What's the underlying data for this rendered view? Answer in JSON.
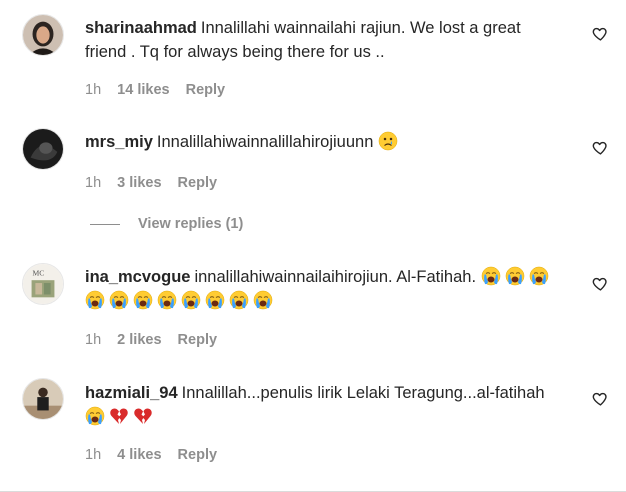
{
  "comments": [
    {
      "username": "sharinaahmad",
      "text": "Innalillahi wainnailahi rajiun. We lost a great friend . Tq for always being there for us ..",
      "time": "1h",
      "likes": "14 likes",
      "reply": "Reply"
    },
    {
      "username": "mrs_miy",
      "text": "Innalillahiwainnalillahirojiuunn",
      "time": "1h",
      "likes": "3 likes",
      "reply": "Reply",
      "view_replies": "View replies (1)"
    },
    {
      "username": "ina_mcvogue",
      "text": "innalillahiwainnailaihirojiun. Al-Fatihah.",
      "time": "1h",
      "likes": "2 likes",
      "reply": "Reply"
    },
    {
      "username": "hazmiali_94",
      "text": "Innalillah...penulis lirik Lelaki Teragung...al-fatihah",
      "time": "1h",
      "likes": "4 likes",
      "reply": "Reply"
    }
  ],
  "avatar_3_logo_text": "MC",
  "icons": {
    "like": "heart-outline-icon",
    "sad_face": "sad-face-emoji",
    "crying": "loudly-crying-emoji",
    "broken_heart": "broken-heart-emoji"
  },
  "colors": {
    "text": "#262626",
    "muted": "#8e8e8e",
    "emoji_yellow": "#ffcc33",
    "tear_blue": "#3aa0ff",
    "heart_red": "#d92b2b"
  }
}
